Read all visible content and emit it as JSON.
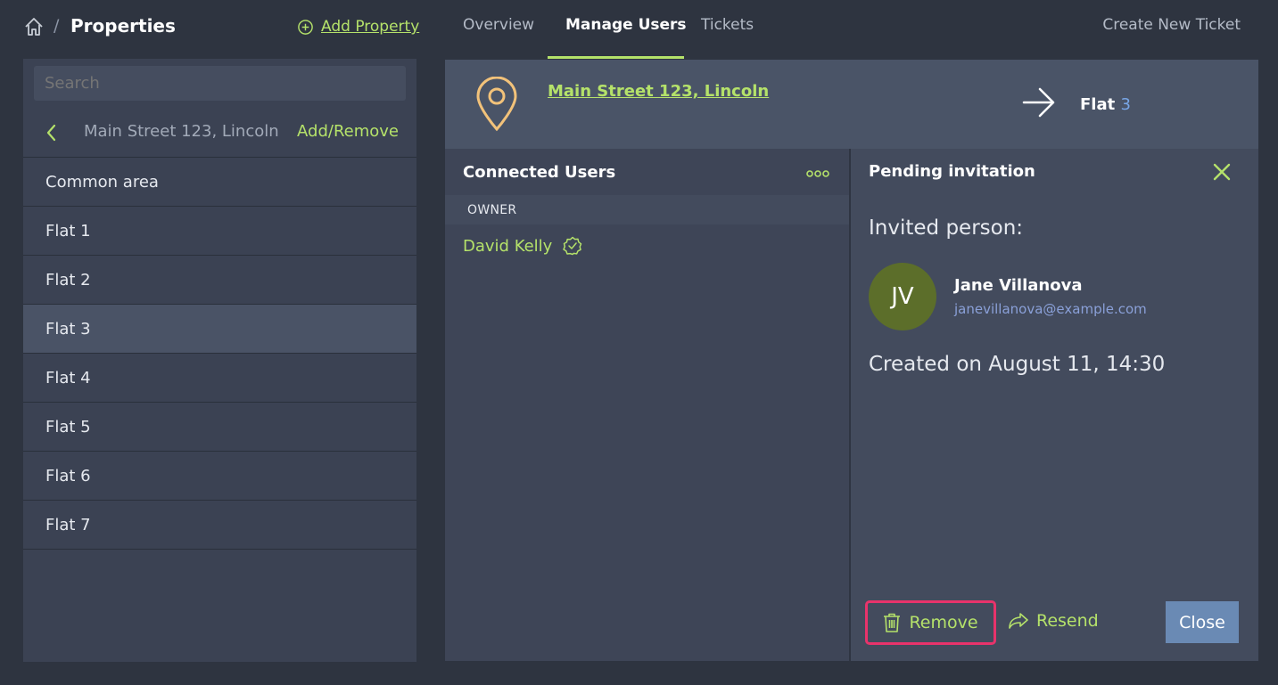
{
  "breadcrumb": {
    "separator": "/",
    "title": "Properties",
    "home_icon": "home-icon"
  },
  "add_property": {
    "label": "Add Property",
    "icon": "plus-circle-icon"
  },
  "tabs": [
    {
      "label": "Overview",
      "active": false
    },
    {
      "label": "Manage Users",
      "active": true
    },
    {
      "label": "Tickets",
      "active": false
    }
  ],
  "create_ticket_label": "Create New Ticket",
  "sidebar": {
    "search_placeholder": "Search",
    "location": "Main Street 123, Lincoln",
    "add_remove_label": "Add/Remove",
    "units": [
      {
        "label": "Common area",
        "selected": false
      },
      {
        "label": "Flat 1",
        "selected": false
      },
      {
        "label": "Flat 2",
        "selected": false
      },
      {
        "label": "Flat 3",
        "selected": true
      },
      {
        "label": "Flat 4",
        "selected": false
      },
      {
        "label": "Flat 5",
        "selected": false
      },
      {
        "label": "Flat 6",
        "selected": false
      },
      {
        "label": "Flat 7",
        "selected": false
      }
    ]
  },
  "property": {
    "address": "Main Street 123, Lincoln",
    "flat_prefix": "Flat",
    "flat_number": "3"
  },
  "connected_users": {
    "title": "Connected Users",
    "role": "OWNER",
    "owner_name": "David Kelly"
  },
  "pending_invitation": {
    "title": "Pending invitation",
    "invited_label": "Invited person:",
    "initials": "JV",
    "name": "Jane Villanova",
    "email": "janevillanova@example.com",
    "created": "Created on August 11, 14:30",
    "remove_label": "Remove",
    "resend_label": "Resend",
    "close_label": "Close"
  },
  "colors": {
    "accent": "#b5e26a",
    "highlight_border": "#e8336b",
    "close_button": "#6a8ab4",
    "avatar": "#5c6e2a",
    "pin": "#f2c27a"
  }
}
